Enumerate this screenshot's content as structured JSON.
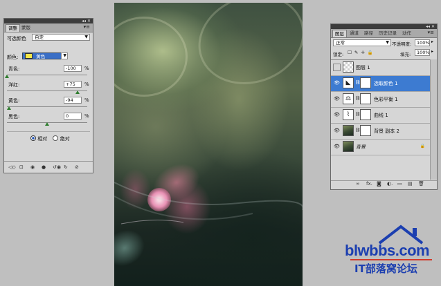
{
  "adjust_panel": {
    "grip_controls": "◂◂ ✕",
    "tabs": [
      "调整",
      "蒙版"
    ],
    "menu": "▾≡",
    "preset_label": "可选颜色",
    "preset_value": "自定",
    "color_label": "颜色:",
    "color_value": "黄色",
    "color_swatch": "#f3e84a",
    "sliders": [
      {
        "label": "青色:",
        "value": "-100",
        "unit": "%",
        "position": 0.0
      },
      {
        "label": "洋红:",
        "value": "+75",
        "unit": "%",
        "position": 0.875
      },
      {
        "label": "黄色:",
        "value": "-94",
        "unit": "%",
        "position": 0.03
      },
      {
        "label": "黑色:",
        "value": "0",
        "unit": "%",
        "position": 0.5
      }
    ],
    "method_relative": "相对",
    "method_absolute": "绝对",
    "footer_icons": [
      "◁◇",
      "⊡",
      "◉",
      "●",
      "↺◉",
      "↻",
      "⊘"
    ]
  },
  "layers_panel": {
    "grip_controls": "◂◂ ✕",
    "tabs": [
      "图层",
      "通道",
      "路径",
      "历史记录",
      "动作"
    ],
    "menu": "▾≡",
    "blend_mode": "正常",
    "opacity_label": "不透明度:",
    "opacity_value": "100%",
    "lock_label": "锁定:",
    "lock_icons": "☐ ✎ ✛ 🔒",
    "fill_label": "填充:",
    "fill_value": "100%",
    "layers": [
      {
        "name": "图层 1",
        "visible": false,
        "selected": false,
        "thumb": "transparent",
        "mask": false,
        "adj_icon": ""
      },
      {
        "name": "选取颜色 1",
        "visible": true,
        "selected": true,
        "thumb": "adj",
        "mask": true,
        "adj_icon": "◣"
      },
      {
        "name": "色彩平衡 1",
        "visible": true,
        "selected": false,
        "thumb": "adj",
        "mask": true,
        "adj_icon": "⚖"
      },
      {
        "name": "曲线 1",
        "visible": true,
        "selected": false,
        "thumb": "adj",
        "mask": true,
        "adj_icon": "⌇"
      },
      {
        "name": "背景 副本 2",
        "visible": true,
        "selected": false,
        "thumb": "photo",
        "mask": true,
        "adj_icon": ""
      },
      {
        "name": "背景",
        "visible": true,
        "selected": false,
        "thumb": "photo",
        "mask": false,
        "adj_icon": "",
        "locked": true
      }
    ],
    "footer_icons": [
      "∞",
      "fx.",
      "◙",
      "◐.",
      "▭",
      "▤",
      "🗑"
    ]
  },
  "watermark": {
    "url": "blwbbs.com",
    "name": "IT部落窝论坛"
  }
}
